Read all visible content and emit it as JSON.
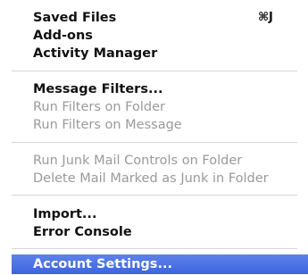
{
  "menu": {
    "items": [
      {
        "label": "Saved Files",
        "shortcut": "⌘J",
        "enabled": true
      },
      {
        "label": "Add-ons",
        "enabled": true
      },
      {
        "label": "Activity Manager",
        "enabled": true
      },
      {
        "label": "Message Filters...",
        "enabled": true
      },
      {
        "label": "Run Filters on Folder",
        "enabled": false
      },
      {
        "label": "Run Filters on Message",
        "enabled": false
      },
      {
        "label": "Run Junk Mail Controls on Folder",
        "enabled": false
      },
      {
        "label": "Delete Mail Marked as Junk in Folder",
        "enabled": false
      },
      {
        "label": "Import...",
        "enabled": true
      },
      {
        "label": "Error Console",
        "enabled": true
      },
      {
        "label": "Account Settings...",
        "enabled": true,
        "highlighted": true
      }
    ],
    "highlight_color": "#3c64de"
  }
}
